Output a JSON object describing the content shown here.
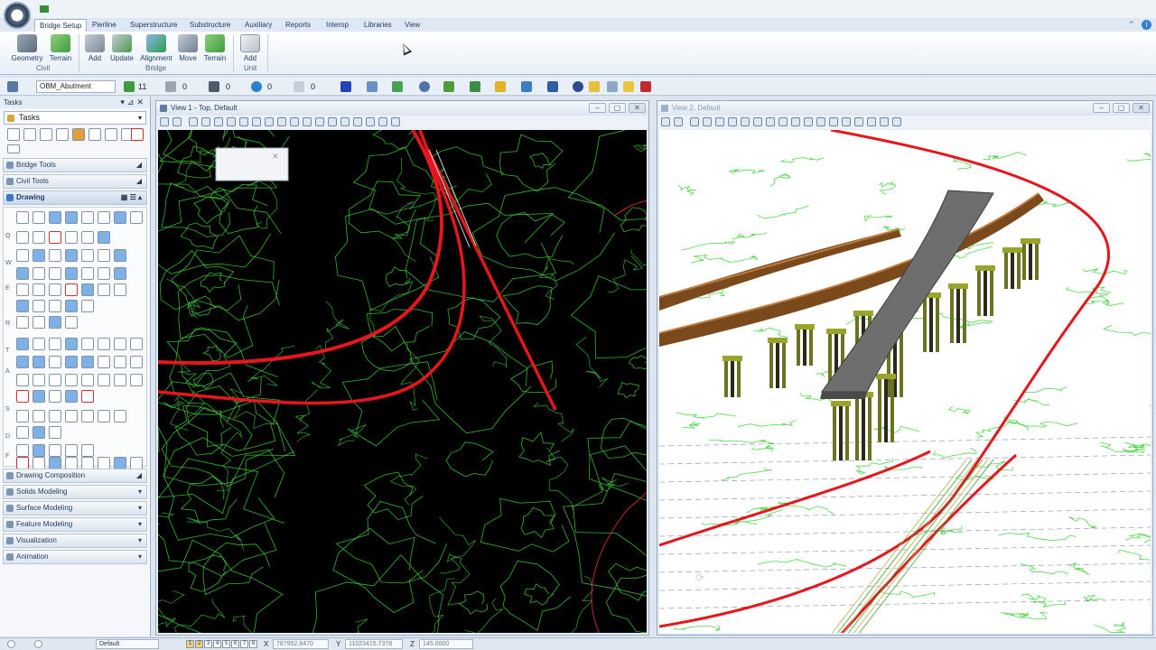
{
  "app": {
    "logo": "3"
  },
  "ribbon": {
    "tabs": [
      "Bridge Setup",
      "Pierline",
      "Superstructure",
      "Substructure",
      "Auxiliary",
      "Reports",
      "Interop",
      "Libraries",
      "View"
    ],
    "active_tab": "Bridge Setup",
    "groups": [
      {
        "label": "Civil",
        "buttons": [
          "Geometry",
          "Terrain"
        ]
      },
      {
        "label": "Bridge",
        "buttons": [
          "Add",
          "Update",
          "Alignment",
          "Move",
          "Terrain"
        ]
      },
      {
        "label": "Unit",
        "buttons": [
          "Add"
        ]
      }
    ]
  },
  "attributes": {
    "level": "OBM_Abutment",
    "color": "11",
    "style": "0",
    "weight": "0",
    "transparency": "0",
    "priority": "0"
  },
  "tasks": {
    "header": "Tasks",
    "selected": "Tasks",
    "sections": [
      "Bridge Tools",
      "Civil Tools",
      "Drawing",
      "Drawing Composition",
      "Solids Modeling",
      "Surface Modeling",
      "Feature Modeling",
      "Visualization",
      "Animation"
    ],
    "row_letters": [
      "Q",
      "W",
      "E",
      "R",
      "T",
      "A",
      "S",
      "D",
      "F"
    ]
  },
  "views": {
    "view1_title": "View 1 - Top, Default",
    "view2_title": "View 2, Default"
  },
  "statusbar": {
    "model": "Default",
    "x_label": "X",
    "x_value": "787952.8470",
    "y_label": "Y",
    "y_value": "11023415.7378",
    "z_label": "Z",
    "z_value": "145.0000",
    "levels": [
      "1",
      "2",
      "3",
      "4",
      "5",
      "6",
      "7",
      "8"
    ]
  },
  "colors": {
    "alignment_red": "#e5161c",
    "contour_green": "#3fd43a",
    "deck_brown": "#7a4a1c",
    "pier_olive": "#9aa32a",
    "slab_gray": "#6e6e6e"
  }
}
